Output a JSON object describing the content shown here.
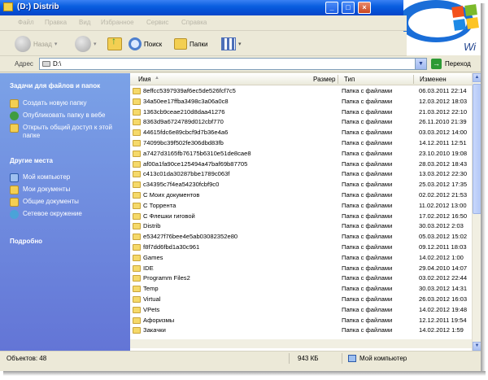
{
  "window": {
    "title": "(D:) Distrib",
    "controls": [
      "_",
      "□",
      "×"
    ]
  },
  "menu": [
    "Файл",
    "Правка",
    "Вид",
    "Избранное",
    "Сервис",
    "Справка"
  ],
  "toolbar": {
    "back_label": "Назад",
    "search_label": "Поиск",
    "folders_label": "Папки"
  },
  "address": {
    "label": "Адрес",
    "value": "D:\\",
    "go_label": "Переход"
  },
  "taskpane": {
    "file_tasks_title": "Задачи для файлов и папок",
    "file_tasks": [
      {
        "label": "Создать новую папку",
        "icon": "new-folder-icon"
      },
      {
        "label": "Опубликовать папку в вебе",
        "icon": "publish-web-icon"
      },
      {
        "label": "Открыть общий доступ к этой папке",
        "icon": "share-folder-icon"
      }
    ],
    "other_places_title": "Другие места",
    "other_places": [
      {
        "label": "Мой компьютер",
        "icon": "my-computer-icon"
      },
      {
        "label": "Мои документы",
        "icon": "my-documents-icon"
      },
      {
        "label": "Общие документы",
        "icon": "shared-documents-icon"
      },
      {
        "label": "Сетевое окружение",
        "icon": "network-icon"
      }
    ],
    "details_title": "Подробно"
  },
  "columns": {
    "name": "Имя",
    "size": "Размер",
    "type": "Тип",
    "modified": "Изменен"
  },
  "files": [
    {
      "name": "8effcc5397939af6ec5de526fcf7c5",
      "type": "Папка с файлами",
      "date": "06.03.2011 22:14"
    },
    {
      "name": "34a50ee17ffba3498c3a06a0c8",
      "type": "Папка с файлами",
      "date": "12.03.2012 18:03"
    },
    {
      "name": "1363cb9ceae210d8daa41276",
      "type": "Папка с файлами",
      "date": "21.03.2012 22:10"
    },
    {
      "name": "8363d9a6724789d012cbf770",
      "type": "Папка с файлами",
      "date": "26.11.2010 21:39"
    },
    {
      "name": "44615fdc6e89cbcf9d7b36e4a6",
      "type": "Папка с файлами",
      "date": "03.03.2012 14:00"
    },
    {
      "name": "74099bc39f502fe306dbd83fb",
      "type": "Папка с файлами",
      "date": "14.12.2011 12:51"
    },
    {
      "name": "a7427d3165fb76175b6310e51de8cae8",
      "type": "Папка с файлами",
      "date": "23.10.2010 19:08"
    },
    {
      "name": "af00a1fa90ce125494a47baf69b87705",
      "type": "Папка с файлами",
      "date": "28.03.2012 18:43"
    },
    {
      "name": "c413c01da30287bbe1789c063f",
      "type": "Папка с файлами",
      "date": "13.03.2012 22:30"
    },
    {
      "name": "c34395c7f4ea54230fcbf9c0",
      "type": "Папка с файлами",
      "date": "25.03.2012 17:35"
    },
    {
      "name": "C Моих документов",
      "type": "Папка с файлами",
      "date": "02.02.2012 21:53"
    },
    {
      "name": "C Торрента",
      "type": "Папка с файлами",
      "date": "11.02.2012 13:00"
    },
    {
      "name": "C Флешки гиговой",
      "type": "Папка с файлами",
      "date": "17.02.2012 16:50"
    },
    {
      "name": "Distrib",
      "type": "Папка с файлами",
      "date": "30.03.2012 2:03"
    },
    {
      "name": "e53427f76bee4e5ab03082352e80",
      "type": "Папка с файлами",
      "date": "05.03.2012 15:02"
    },
    {
      "name": "f8f7dd6fbd1a30c961",
      "type": "Папка с файлами",
      "date": "09.12.2011 18:03"
    },
    {
      "name": "Games",
      "type": "Папка с файлами",
      "date": "14.02.2012 1:00"
    },
    {
      "name": "IDE",
      "type": "Папка с файлами",
      "date": "29.04.2010 14:07"
    },
    {
      "name": "Programm Files2",
      "type": "Папка с файлами",
      "date": "03.02.2012 22:44"
    },
    {
      "name": "Temp",
      "type": "Папка с файлами",
      "date": "30.03.2012 14:31"
    },
    {
      "name": "Virtual",
      "type": "Папка с файлами",
      "date": "26.03.2012 16:03"
    },
    {
      "name": "VPets",
      "type": "Папка с файлами",
      "date": "14.02.2012 19:48"
    },
    {
      "name": "Афоризмы",
      "type": "Папка с файлами",
      "date": "12.12.2011 19:54"
    },
    {
      "name": "Закачки",
      "type": "Папка с файлами",
      "date": "14.02.2012 1:59"
    }
  ],
  "status": {
    "objects": "Объектов: 48",
    "size": "943 КБ",
    "location": "Мой компьютер"
  },
  "colors": {
    "titlebar": "#0550d5",
    "taskpane_top": "#7ba2e7",
    "taskpane_bottom": "#6375d6",
    "folder": "#f5d96a"
  }
}
